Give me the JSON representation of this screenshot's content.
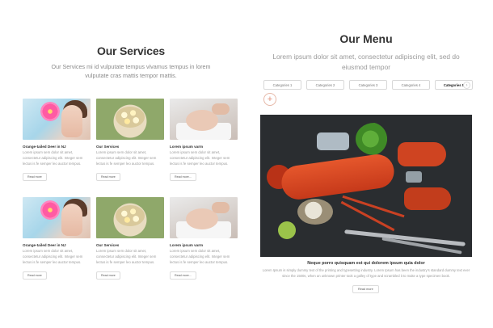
{
  "services": {
    "title": "Our Services",
    "intro": "Our Services mi id vulputate tempus vivamus tempus in lorem vulputate cras mattis tempor mattis.",
    "row1": [
      {
        "title": "Orange-tailed Deer in NJ",
        "desc": "Lorem ipsum sem dolor sit amet, consectetur adipiscing elit. Integer sem lectus is fe semper leo auctor tempus.",
        "button": "Read more",
        "image": "woman-with-flower"
      },
      {
        "title": "Our Services",
        "desc": "Lorem ipsum sem dolor sit amet, consectetur adipiscing elit. Integer sem lectus is fe semper leo auctor tempus.",
        "button": "Read more",
        "image": "flower-bowl"
      },
      {
        "title": "Lorem ipsum varm",
        "desc": "Lorem ipsum sem dolor sit amet, consectetur adipiscing elit. Integer sem lectus is fe semper leo auctor tempus.",
        "button": "Read more...",
        "image": "facial-massage"
      }
    ],
    "row2": [
      {
        "title": "Orange-tailed Deer in NJ",
        "desc": "Lorem ipsum sem dolor sit amet, consectetur adipiscing elit. Integer sem lectus is fe semper leo auctor tempus.",
        "button": "Read more",
        "image": "woman-with-flower"
      },
      {
        "title": "Our Services",
        "desc": "Lorem ipsum sem dolor sit amet, consectetur adipiscing elit. Integer sem lectus is fe semper leo auctor tempus.",
        "button": "Read more",
        "image": "flower-bowl"
      },
      {
        "title": "Lorem ipsum varm",
        "desc": "Lorem ipsum sem dolor sit amet, consectetur adipiscing elit. Integer sem lectus is fe semper leo auctor tempus.",
        "button": "Read more...",
        "image": "facial-massage"
      }
    ]
  },
  "menu": {
    "title": "Our Menu",
    "intro": "Lorem ipsum dolor sit amet, consectetur adipiscing elit, sed do eiusmod tempor",
    "tabs": [
      "Categories 1",
      "Categories 2",
      "Categories 3",
      "Categories 4",
      "Categories 5"
    ],
    "active_tab": "Categories 5",
    "next_icon": "›",
    "add_icon": "+",
    "dish": {
      "image": "lobster-seafood-plate",
      "title": "Neque porro quisquam est qui dolorem ipsum quia dolor",
      "desc": "Lorem Ipsum is simply dummy text of the printing and typesetting industry. Lorem Ipsum has been the industry's standard dummy text ever since the 1500s, when an unknown printer took a galley of type and scrambled it to make a type specimen book.",
      "button": "Read more"
    }
  },
  "colors": {
    "accent": "#e08b73",
    "text": "#333333",
    "muted": "#9a9a9a",
    "border": "#d8d8d8"
  }
}
